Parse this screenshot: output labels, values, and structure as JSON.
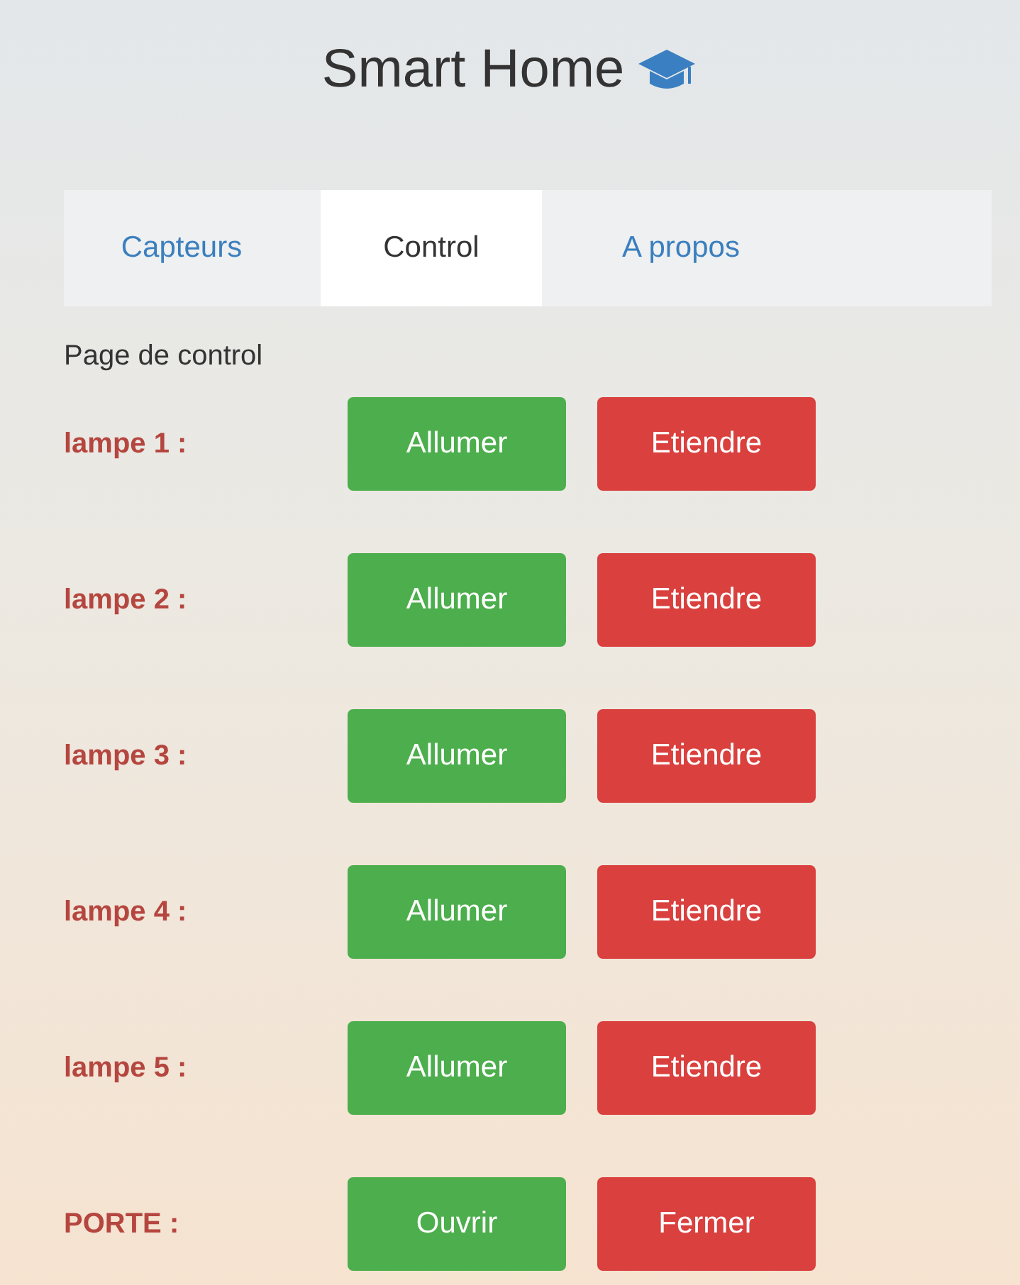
{
  "title": "Smart Home",
  "tabs": [
    {
      "label": "Capteurs",
      "selected": false
    },
    {
      "label": "Control",
      "selected": true
    },
    {
      "label": "A propos",
      "selected": false
    }
  ],
  "page_heading": "Page de control",
  "rows": [
    {
      "label": "lampe 1 :",
      "on_button": "Allumer",
      "off_button": "Etiendre"
    },
    {
      "label": "lampe 2 :",
      "on_button": "Allumer",
      "off_button": "Etiendre"
    },
    {
      "label": "lampe 3 :",
      "on_button": "Allumer",
      "off_button": "Etiendre"
    },
    {
      "label": "lampe 4 :",
      "on_button": "Allumer",
      "off_button": "Etiendre"
    },
    {
      "label": "lampe 5 :",
      "on_button": "Allumer",
      "off_button": "Etiendre"
    },
    {
      "label": "PORTE :",
      "on_button": "Ouvrir",
      "off_button": "Fermer"
    }
  ]
}
